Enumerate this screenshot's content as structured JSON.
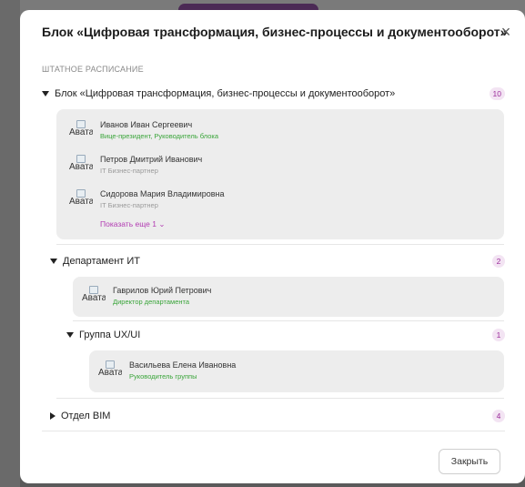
{
  "modal": {
    "title": "Блок «Цифровая трансформация, бизнес-процессы и документооборот»",
    "close_glyph": "×",
    "section_label": "ШТАТНОЕ РАСПИСАНИЕ",
    "footer_close": "Закрыть"
  },
  "avatar_alt": "Аватар",
  "colors": {
    "accent": "#b23bb2",
    "role_green": "#3aa53a",
    "role_gray": "#9a9a9a",
    "badge_bg": "#f3e4f3"
  },
  "tree": {
    "root": {
      "label": "Блок «Цифровая трансформация, бизнес-процессы и документооборот»",
      "count": "10",
      "members": [
        {
          "name": "Иванов Иван Сергеевич",
          "role": "Вице-президент, Руководитель блока"
        },
        {
          "name": "Петров Дмитрий Иванович",
          "role": "IT Бизнес-партнер"
        },
        {
          "name": "Сидорова Мария Владимировна",
          "role": "IT Бизнес-партнер"
        }
      ],
      "show_more": "Показать еще 1"
    },
    "dept": {
      "label": "Департамент ИТ",
      "count": "2",
      "members": [
        {
          "name": "Гаврилов Юрий Петрович",
          "role": "Директор департамента"
        }
      ]
    },
    "group": {
      "label": "Группа UX/UI",
      "count": "1",
      "members": [
        {
          "name": "Васильева Елена Ивановна",
          "role": "Руководитель группы"
        }
      ]
    },
    "bim": {
      "label": "Отдел BIM",
      "count": "4"
    }
  }
}
